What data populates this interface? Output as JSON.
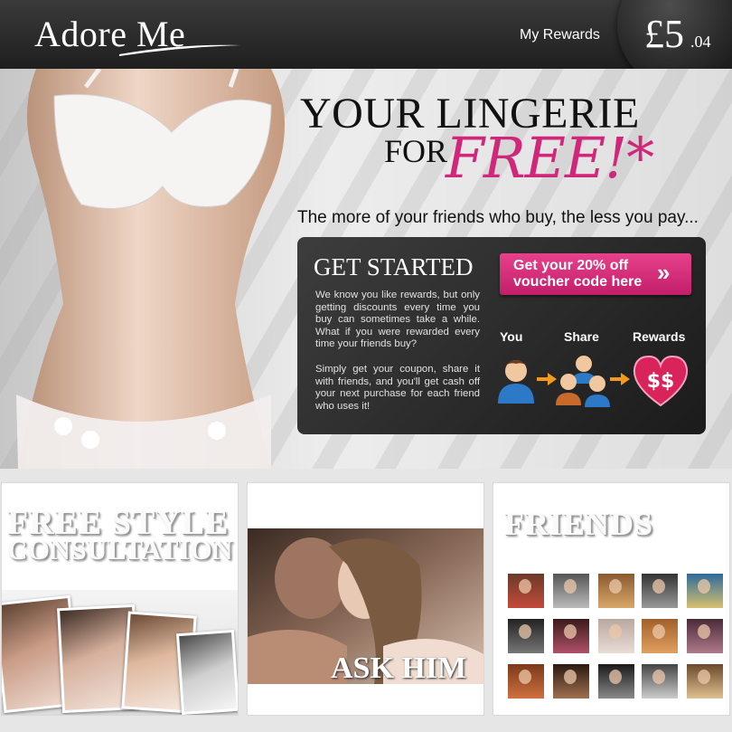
{
  "header": {
    "logo": "Adore Me",
    "rewards_link": "My Rewards",
    "balance_pounds": "£5",
    "balance_pence": ".04"
  },
  "hero": {
    "title": "YOUR LINGERIE",
    "for": "FOR",
    "free": "FREE!*",
    "tagline": "The more of your friends who buy, the less you pay..."
  },
  "get_started": {
    "title": "GET STARTED",
    "para1": "We know you like rewards, but only getting discounts every time you buy can sometimes take a while. What if you were rewarded every time your friends buy?",
    "para2": "Simply get your coupon, share it with friends, and you'll get cash off your next purchase for each friend who uses it!",
    "cta_label": "Get your 20% off voucher code here",
    "cta_arrows": "»",
    "steps": [
      "You",
      "Share",
      "Rewards"
    ],
    "step_icons": [
      "person-icon",
      "group-icon",
      "dollar-heart-icon"
    ]
  },
  "cards": {
    "consultation_line1": "FREE STYLE",
    "consultation_line2": "CONSULTATION",
    "ask_him": "ASK HIM",
    "friends_title": "FRIENDS"
  },
  "colors": {
    "accent_pink": "#d0277a",
    "header_dark": "#262626"
  }
}
